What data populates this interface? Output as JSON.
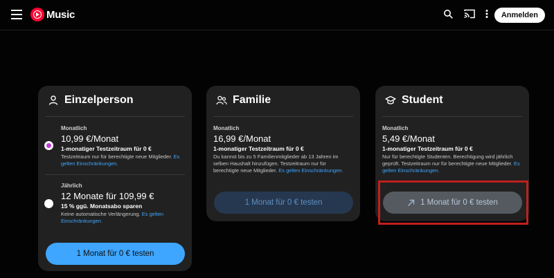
{
  "header": {
    "app_name": "Music",
    "signin_label": "Anmelden",
    "icons": [
      "menu-icon",
      "youtube-music-logo-icon",
      "search-icon",
      "cast-icon",
      "more-vert-icon"
    ]
  },
  "cards": [
    {
      "title": "Einzelperson",
      "icon": "person-icon",
      "plans": [
        {
          "label": "Monatlich",
          "price": "10,99 €/Monat",
          "offer": "1-monatiger Testzeitraum für 0 €",
          "desc": "Testzeitraum nur für berechtigte neue Mitglieder.",
          "link": "Es gelten Einschränkungen.",
          "selected": true
        },
        {
          "label": "Jährlich",
          "price": "12 Monate für 109,99 €",
          "offer": "15 % ggü. Monatsabo sparen",
          "desc": "Keine automatische Verlängerung.",
          "link": "Es gelten Einschränkungen.",
          "selected": false
        }
      ],
      "cta": "1 Monat für 0 € testen"
    },
    {
      "title": "Familie",
      "icon": "family-icon",
      "plan": {
        "label": "Monatlich",
        "price": "16,99 €/Monat",
        "offer": "1-monatiger Testzeitraum für 0 €",
        "desc": "Du kannst bis zu 5 Familienmitglieder ab 13 Jahren im selben Haushalt hinzufügen. Testzeitraum nur für berechtigte neue Mitglieder.",
        "link": "Es gelten Einschränkungen."
      },
      "cta": "1 Monat für 0 € testen"
    },
    {
      "title": "Student",
      "icon": "graduation-cap-icon",
      "plan": {
        "label": "Monatlich",
        "price": "5,49 €/Monat",
        "offer": "1-monatiger Testzeitraum für 0 €",
        "desc": "Nur für berechtigte Studenten. Berechtigung wird jährlich geprüft. Testzeitraum nur für berechtigte neue Mitglieder.",
        "link": "Es gelten Einschränkungen."
      },
      "cta": "1 Monat für 0 € testen",
      "cta_icon": "external-link-arrow-icon"
    }
  ],
  "colors": {
    "accent": "#3ea6ff",
    "brand": "#ff0033",
    "radio_selected": "#c13dd6",
    "highlight": "#c0201e"
  }
}
